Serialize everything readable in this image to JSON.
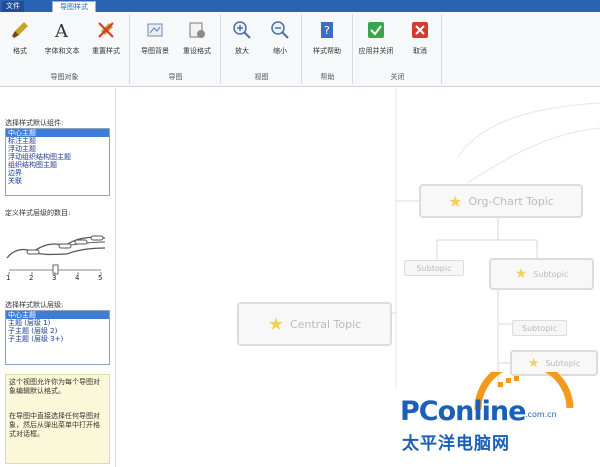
{
  "tabs": {
    "file": "文件",
    "active": "导图样式"
  },
  "ribbon": {
    "groups": [
      {
        "label": "导图对象",
        "buttons": [
          "格式",
          "字体和文本",
          "重置样式"
        ]
      },
      {
        "label": "导图",
        "buttons": [
          "导图背景",
          "重设格式"
        ]
      },
      {
        "label": "视图",
        "buttons": [
          "放大",
          "缩小"
        ]
      },
      {
        "label": "帮助",
        "buttons": [
          "样式帮助"
        ]
      },
      {
        "label": "关闭",
        "buttons": [
          "应用并关闭",
          "取消"
        ]
      }
    ]
  },
  "left": {
    "sec1_label": "选择样式默认组件:",
    "list1": [
      "中心主题",
      "标注主题",
      "浮动主题",
      "浮动组织结构图主题",
      "组织结构图主题",
      "边界",
      "关联"
    ],
    "sec2_label": "定义样式层级的数目:",
    "ticks": [
      "1",
      "2",
      "3",
      "4",
      "5"
    ],
    "sec3_label": "选择样式默认层级:",
    "list2": [
      "中心主题",
      "主题 (层级 1)",
      "子主题 (层级 2)",
      "子主题 (层级 3+)"
    ],
    "hint1": "这个视图允许你为每个导图对象编辑默认格式。",
    "hint2": "在导图中直接选择任何导图对象，然后从弹出菜单中打开格式对话框。"
  },
  "canvas": {
    "org_topic": "Org-Chart Topic",
    "central_topic": "Central Topic",
    "subtopic": "Subtopic"
  },
  "watermark": {
    "brand": "PConline",
    "domain": ".com.cn",
    "cn": "太平洋电脑网"
  },
  "colors": {
    "accent": "#2b63b4",
    "selection": "#3f7cd8",
    "brand": "#1b5fb7",
    "orange": "#f39a1e"
  }
}
